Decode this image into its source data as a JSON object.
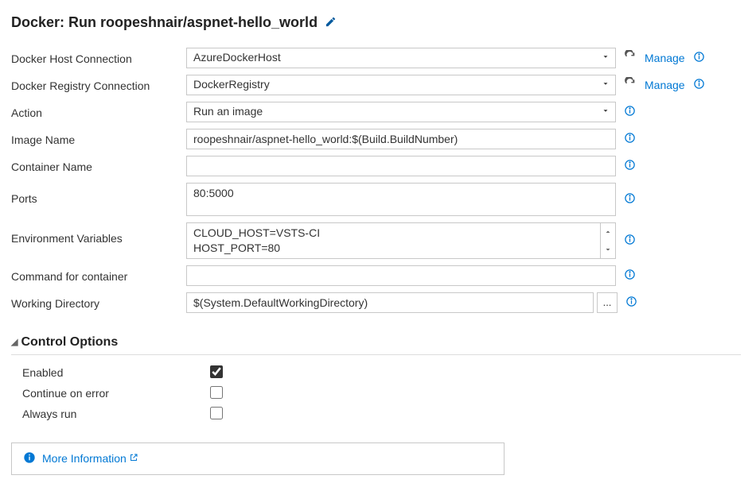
{
  "title": "Docker: Run roopeshnair/aspnet-hello_world",
  "fields": {
    "dockerHost": {
      "label": "Docker Host Connection",
      "value": "AzureDockerHost",
      "manage": "Manage"
    },
    "dockerRegistry": {
      "label": "Docker Registry Connection",
      "value": "DockerRegistry",
      "manage": "Manage"
    },
    "action": {
      "label": "Action",
      "value": "Run an image"
    },
    "imageName": {
      "label": "Image Name",
      "value": "roopeshnair/aspnet-hello_world:$(Build.BuildNumber)"
    },
    "containerName": {
      "label": "Container Name",
      "value": ""
    },
    "ports": {
      "label": "Ports",
      "value": "80:5000"
    },
    "envVars": {
      "label": "Environment Variables",
      "value": "CLOUD_HOST=VSTS-CI\nHOST_PORT=80"
    },
    "command": {
      "label": "Command for container",
      "value": ""
    },
    "workingDir": {
      "label": "Working Directory",
      "value": "$(System.DefaultWorkingDirectory)"
    }
  },
  "controlOptions": {
    "header": "Control Options",
    "enabled": {
      "label": "Enabled",
      "checked": true
    },
    "continueOnError": {
      "label": "Continue on error",
      "checked": false
    },
    "alwaysRun": {
      "label": "Always run",
      "checked": false
    }
  },
  "moreInfo": {
    "label": "More Information"
  }
}
